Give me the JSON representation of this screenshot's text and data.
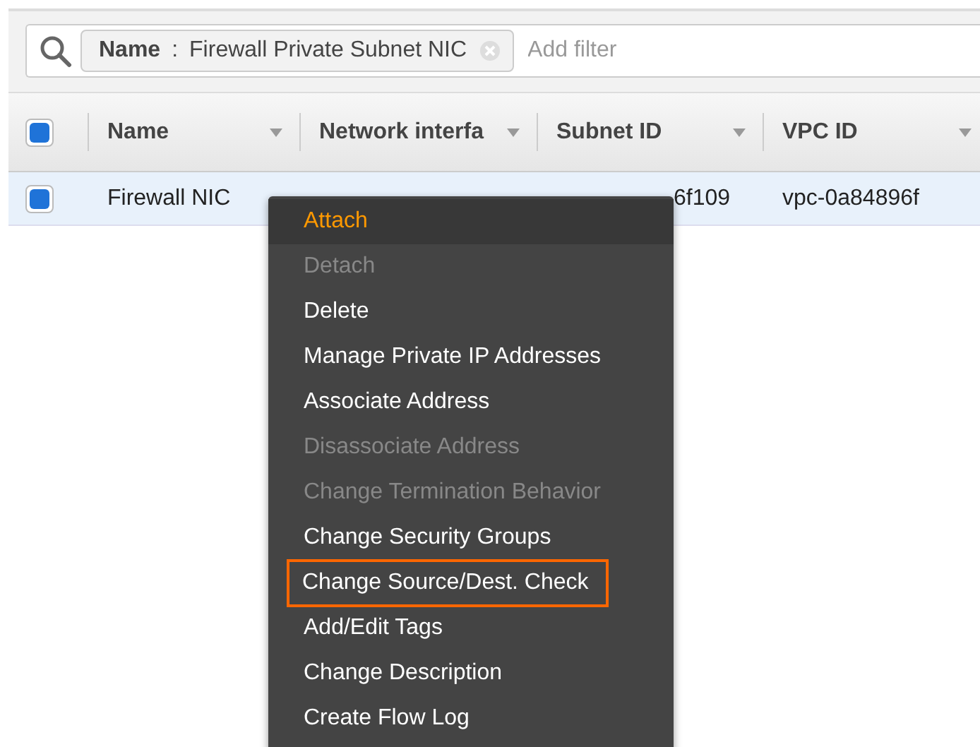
{
  "search": {
    "filter_tokens": [
      {
        "key": "Name",
        "separator": ":",
        "value": "Firewall Private Subnet NIC"
      }
    ],
    "placeholder": "Add filter"
  },
  "table": {
    "select_all_checked": true,
    "columns": [
      {
        "label": "Name"
      },
      {
        "label": "Network interfa"
      },
      {
        "label": "Subnet ID"
      },
      {
        "label": "VPC ID"
      }
    ],
    "rows": [
      {
        "checked": true,
        "selected": true,
        "cells": [
          "Firewall NIC",
          "",
          "6f109",
          "vpc-0a84896f"
        ]
      }
    ]
  },
  "context_menu": {
    "items": [
      {
        "label": "Attach",
        "disabled": false,
        "hovered": true,
        "outlined": false
      },
      {
        "label": "Detach",
        "disabled": true,
        "hovered": false,
        "outlined": false
      },
      {
        "label": "Delete",
        "disabled": false,
        "hovered": false,
        "outlined": false
      },
      {
        "label": "Manage Private IP Addresses",
        "disabled": false,
        "hovered": false,
        "outlined": false
      },
      {
        "label": "Associate Address",
        "disabled": false,
        "hovered": false,
        "outlined": false
      },
      {
        "label": "Disassociate Address",
        "disabled": true,
        "hovered": false,
        "outlined": false
      },
      {
        "label": "Change Termination Behavior",
        "disabled": true,
        "hovered": false,
        "outlined": false
      },
      {
        "label": "Change Security Groups",
        "disabled": false,
        "hovered": false,
        "outlined": false
      },
      {
        "label": "Change Source/Dest. Check",
        "disabled": false,
        "hovered": false,
        "outlined": true
      },
      {
        "label": "Add/Edit Tags",
        "disabled": false,
        "hovered": false,
        "outlined": false
      },
      {
        "label": "Change Description",
        "disabled": false,
        "hovered": false,
        "outlined": false
      },
      {
        "label": "Create Flow Log",
        "disabled": false,
        "hovered": false,
        "outlined": false
      }
    ]
  }
}
